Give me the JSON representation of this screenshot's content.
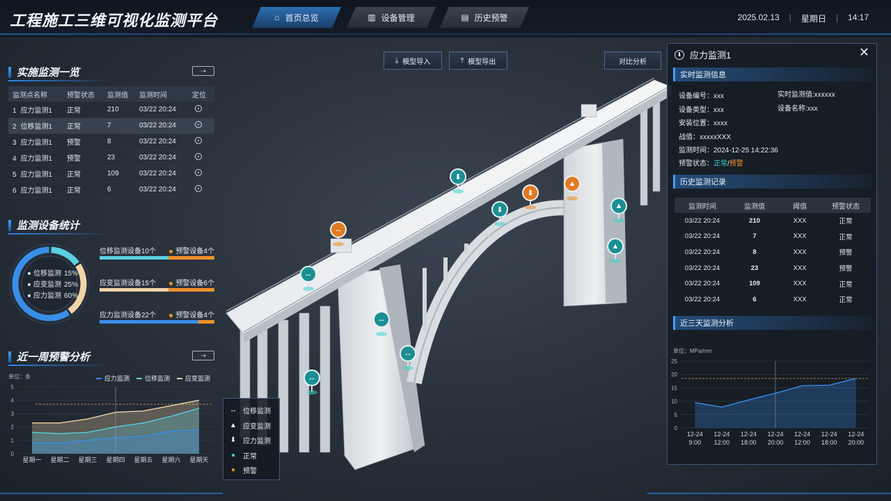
{
  "header": {
    "title": "工程施工三维可视化监测平台",
    "tabs": [
      {
        "label": "首页总览",
        "icon": "home-icon",
        "active": true
      },
      {
        "label": "设备管理",
        "icon": "device-icon",
        "active": false
      },
      {
        "label": "历史预警",
        "icon": "history-icon",
        "active": false
      }
    ],
    "date": "2025.02.13",
    "weekday": "星期日",
    "time": "14:17"
  },
  "monitor_list": {
    "title": "实施监测一览",
    "columns": [
      "监测点名称",
      "预警状态",
      "监测值",
      "监测时间",
      "定位"
    ],
    "rows": [
      {
        "idx": "1",
        "name": "应力监测1",
        "status": "正常",
        "level": "ok",
        "value": "210",
        "time": "03/22 20:24"
      },
      {
        "idx": "2",
        "name": "位移监测1",
        "status": "正常",
        "level": "ok",
        "value": "7",
        "time": "03/22 20:24"
      },
      {
        "idx": "3",
        "name": "应力监测1",
        "status": "预警",
        "level": "warn",
        "value": "8",
        "time": "03/22 20:24"
      },
      {
        "idx": "4",
        "name": "应力监测1",
        "status": "预警",
        "level": "warn",
        "value": "23",
        "time": "03/22 20:24"
      },
      {
        "idx": "5",
        "name": "应力监测1",
        "status": "正常",
        "level": "ok",
        "value": "109",
        "time": "03/22 20:24"
      },
      {
        "idx": "6",
        "name": "应力监测1",
        "status": "正常",
        "level": "ok",
        "value": "6",
        "time": "03/22 20:24"
      }
    ]
  },
  "device_stats": {
    "title": "监测设备统计",
    "donut": [
      {
        "label": "位移监测",
        "pct": "15%",
        "value": 15,
        "color": "#5ad0e0"
      },
      {
        "label": "应变监测",
        "pct": "25%",
        "value": 25,
        "color": "#f3d3a8"
      },
      {
        "label": "应力监测",
        "pct": "60%",
        "value": 60,
        "color": "#3a8de8"
      }
    ],
    "bars": [
      {
        "label": "位移监测设备10个",
        "warn": "预警设备4个",
        "ratio": 0.6,
        "color": "#5ad0e0"
      },
      {
        "label": "应变监测设备15个",
        "warn": "预警设备6个",
        "ratio": 0.6,
        "color": "#f3d3a8"
      },
      {
        "label": "应力监测设备22个",
        "warn": "预警设备4个",
        "ratio": 0.86,
        "color": "#3a8de8"
      }
    ]
  },
  "week_chart_title": "近一周预警分析",
  "chart_data": [
    {
      "type": "area",
      "title": "近一周预警分析",
      "ylabel": "单位：条",
      "categories": [
        "星期一",
        "星期二",
        "星期三",
        "星期四",
        "星期五",
        "星期六",
        "星期天"
      ],
      "ylim": [
        0,
        5
      ],
      "yticks": [
        0,
        1,
        2,
        3,
        4,
        5
      ],
      "threshold": 3.7,
      "legend_position": "top-right",
      "series": [
        {
          "name": "应力监测",
          "color": "#3a8de8",
          "values": [
            0.8,
            0.8,
            1.0,
            1.2,
            1.3,
            1.7,
            1.8
          ]
        },
        {
          "name": "位移监测",
          "color": "#5ad0e0",
          "values": [
            1.6,
            1.5,
            1.6,
            2.0,
            2.3,
            2.8,
            3.4
          ]
        },
        {
          "name": "应变监测",
          "color": "#f3d3a8",
          "values": [
            2.3,
            2.3,
            2.6,
            3.1,
            3.2,
            3.6,
            4.0
          ]
        }
      ]
    },
    {
      "type": "area",
      "title": "近三天监测分析",
      "ylabel": "单位：MPa/mm",
      "categories": [
        "12-24\n9:00",
        "12-24\n12:00",
        "12-24\n18:00",
        "12-24\n20:00",
        "12-24\n12:00",
        "12-24\n18:00",
        "12-24\n20:00"
      ],
      "ylim": [
        0,
        25
      ],
      "yticks": [
        0,
        5,
        10,
        15,
        20,
        25
      ],
      "threshold": 18.5,
      "legend_position": "none",
      "series": [
        {
          "name": "",
          "color": "#3a8de8",
          "values": [
            9.5,
            7.8,
            10.5,
            13,
            15.8,
            16,
            18.5
          ]
        }
      ]
    }
  ],
  "tools": {
    "import": "模型导入",
    "export": "模型导出",
    "compare": "对比分析"
  },
  "detail": {
    "title": "应力监测1",
    "realtime_title": "实时监测信息",
    "left": [
      {
        "label": "设备编号：",
        "value": "xxx"
      },
      {
        "label": "设备类型：",
        "value": "xxx"
      },
      {
        "label": "安装位置：",
        "value": "xxxx"
      },
      {
        "label": "战值：",
        "value": "xxxxxXXX"
      },
      {
        "label": "监测时间：",
        "value": "2024-12-25 14:22:36"
      }
    ],
    "right": [
      {
        "label": "实时监测值:",
        "value": "xxxxxx"
      },
      {
        "label": "设备名称:",
        "value": "xxx"
      }
    ],
    "status_label": "预警状态：",
    "status_ok": "正常",
    "status_sep": "/",
    "status_warn": "预警",
    "history_title": "历史监测记录",
    "history_columns": [
      "监测时间",
      "监测值",
      "阈值",
      "预警状态"
    ],
    "history_rows": [
      {
        "time": "03/22 20:24",
        "value": "210",
        "th": "XXX",
        "status": "正常",
        "level": "ok"
      },
      {
        "time": "03/22 20:24",
        "value": "7",
        "th": "XXX",
        "status": "正常",
        "level": "ok"
      },
      {
        "time": "03/22 20:24",
        "value": "8",
        "th": "XXX",
        "status": "预警",
        "level": "warn"
      },
      {
        "time": "03/22 20:24",
        "value": "23",
        "th": "XXX",
        "status": "预警",
        "level": "warn"
      },
      {
        "time": "03/22 20:24",
        "value": "109",
        "th": "XXX",
        "status": "正常",
        "level": "ok"
      },
      {
        "time": "03/22 20:24",
        "value": "6",
        "th": "XXX",
        "status": "正常",
        "level": "ok"
      }
    ],
    "analysis_title": "近三天监测分析"
  },
  "legend": [
    {
      "icon": "displacement-icon",
      "glyph": "↔",
      "label": "位移监测"
    },
    {
      "icon": "strain-icon",
      "glyph": "▲",
      "label": "应变监测"
    },
    {
      "icon": "stress-icon",
      "glyph": "⬇",
      "label": "应力监测"
    },
    {
      "icon": "normal-dot-icon",
      "glyph": "●",
      "label": "正常",
      "color": "#3ad3c8"
    },
    {
      "icon": "warning-dot-icon",
      "glyph": "●",
      "label": "预警",
      "color": "#f0902a"
    }
  ],
  "markers": [
    {
      "type": "stress",
      "glyph": "⬇",
      "level": "ok"
    },
    {
      "type": "stress",
      "glyph": "⬇",
      "level": "warn"
    },
    {
      "type": "strain",
      "glyph": "▲",
      "level": "warn"
    },
    {
      "type": "stress",
      "glyph": "⬇",
      "level": "ok"
    },
    {
      "type": "strain",
      "glyph": "▲",
      "level": "ok"
    },
    {
      "type": "strain",
      "glyph": "▲",
      "level": "ok"
    },
    {
      "type": "displacement",
      "glyph": "↔",
      "level": "warn"
    },
    {
      "type": "displacement",
      "glyph": "↔",
      "level": "ok"
    },
    {
      "type": "displacement",
      "glyph": "↔",
      "level": "ok"
    },
    {
      "type": "displacement",
      "glyph": "↔",
      "level": "ok"
    },
    {
      "type": "displacement",
      "glyph": "↔",
      "level": "ok"
    }
  ],
  "colors": {
    "accent": "#3a8de8",
    "ok": "#3ad3c8",
    "warn": "#f0902a",
    "panel_border": "#3c5878"
  }
}
